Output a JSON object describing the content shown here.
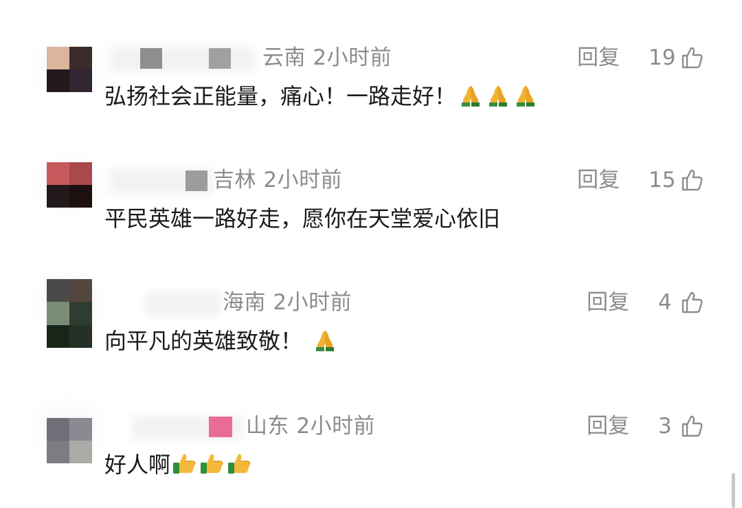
{
  "comments": [
    {
      "region_time": "云南  2小时前",
      "reply": "回复",
      "likes": "19",
      "text": "弘扬社会正能量，痛心！一路走好！",
      "emoji": "folded-hands",
      "emoji_count": 3
    },
    {
      "region_time": "吉林  2小时前",
      "reply": "回复",
      "likes": "15",
      "text": "平民英雄一路好走，愿你在天堂爱心依旧",
      "emoji": "",
      "emoji_count": 0
    },
    {
      "region_time": "海南  2小时前",
      "reply": "回复",
      "likes": "4",
      "text": "向平凡的英雄致敬！",
      "emoji": "folded-hands",
      "emoji_count": 1
    },
    {
      "region_time": "山东  2小时前",
      "reply": "回复",
      "likes": "3",
      "text": "好人啊",
      "emoji": "thumbs-up",
      "emoji_count": 3
    }
  ],
  "colors": {
    "meta_text": "#8c8c8c",
    "body_text": "#1a1a1a",
    "background": "#ffffff"
  },
  "icons": {
    "like": "thumb-up-outline-icon",
    "emoji_pray": "folded-hands-icon",
    "emoji_thumb": "thumbs-up-emoji-icon"
  }
}
